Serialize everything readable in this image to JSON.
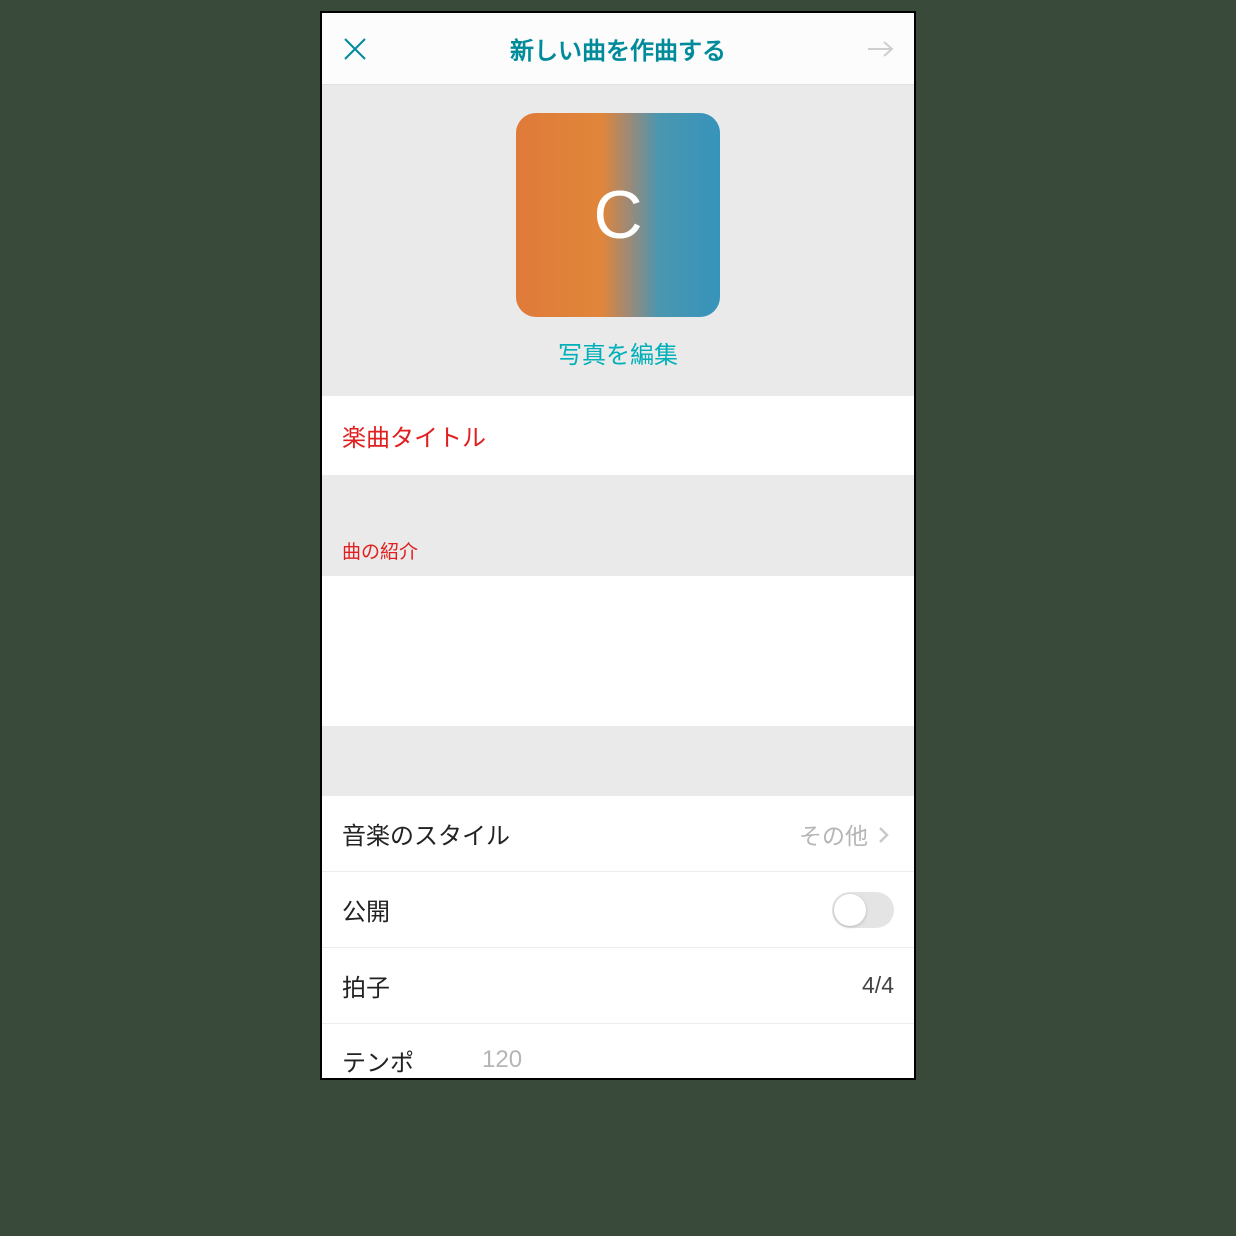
{
  "header": {
    "title": "新しい曲を作曲する"
  },
  "cover": {
    "letter": "C",
    "editPhotoLabel": "写真を編集"
  },
  "titleField": {
    "placeholder": "楽曲タイトル"
  },
  "introField": {
    "label": "曲の紹介"
  },
  "rows": {
    "style": {
      "label": "音楽のスタイル",
      "value": "その他"
    },
    "public": {
      "label": "公開",
      "on": false
    },
    "meter": {
      "label": "拍子",
      "value": "4/4"
    },
    "tempo": {
      "label": "テンポ",
      "value": "120"
    }
  },
  "colors": {
    "accent": "#008b9a",
    "error": "#e02020"
  }
}
